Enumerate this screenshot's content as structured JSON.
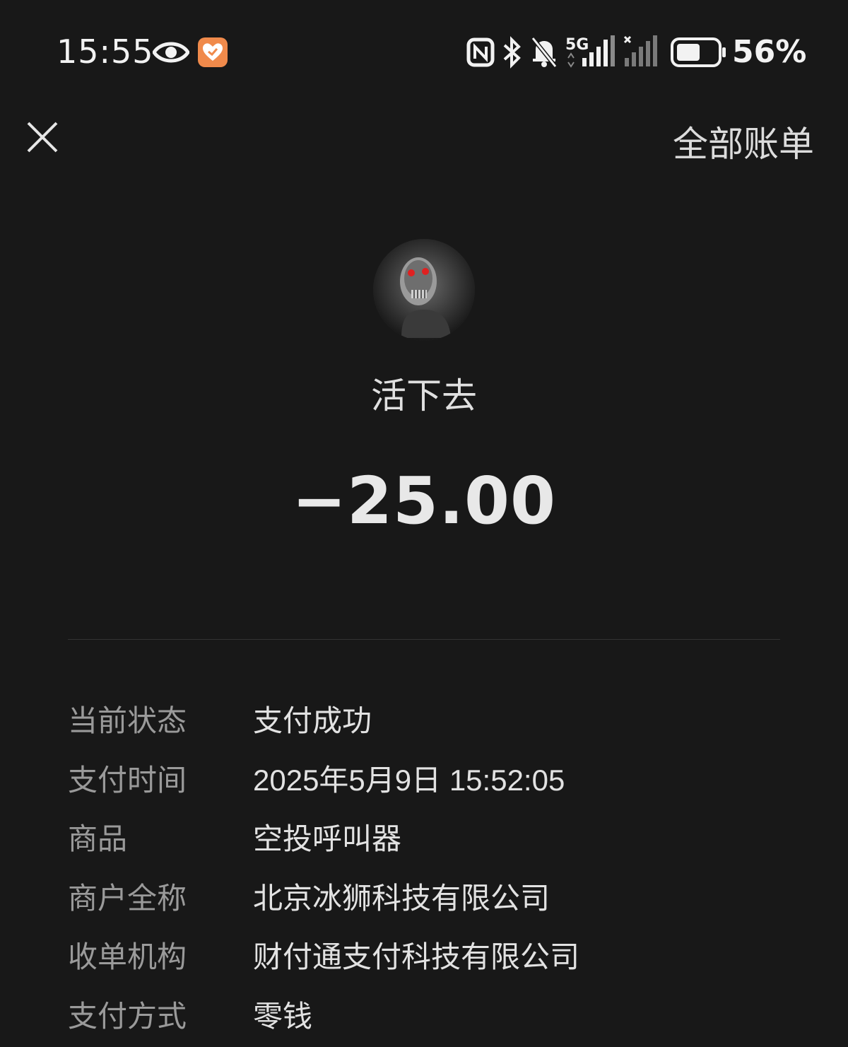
{
  "status_bar": {
    "time": "15:55",
    "battery_percent": "56%",
    "network": "5G"
  },
  "header": {
    "all_bills_label": "全部账单"
  },
  "payee": {
    "name": "活下去"
  },
  "amount": "−25.00",
  "details": [
    {
      "label": "当前状态",
      "value": "支付成功"
    },
    {
      "label": "支付时间",
      "value": "2025年5月9日 15:52:05"
    },
    {
      "label": "商品",
      "value": "空投呼叫器"
    },
    {
      "label": "商户全称",
      "value": "北京冰狮科技有限公司"
    },
    {
      "label": "收单机构",
      "value": "财付通支付科技有限公司"
    },
    {
      "label": "支付方式",
      "value": "零钱"
    }
  ],
  "colors": {
    "background": "#181818",
    "label": "#9a9a9a",
    "value": "#e2e2e2",
    "badge": "#f08a4b"
  }
}
